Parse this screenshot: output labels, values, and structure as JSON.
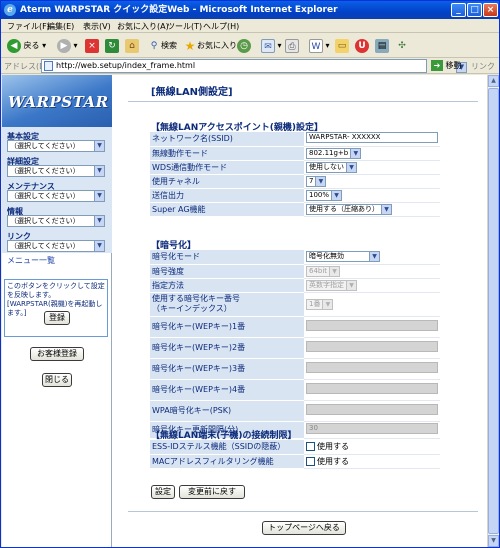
{
  "window": {
    "title": "Aterm WARPSTAR クイック設定Web - Microsoft Internet Explorer",
    "minimize_glyph": "_",
    "maximize_glyph": "□",
    "close_glyph": "×"
  },
  "menubar": [
    "ファイル(F)",
    "編集(E)",
    "表示(V)",
    "お気に入り(A)",
    "ツール(T)",
    "ヘルプ(H)"
  ],
  "toolbar": {
    "back_label": "戻る",
    "search_label": "検索",
    "favorites_label": "お気に入り"
  },
  "address_bar": {
    "label": "アドレス(D)",
    "url": "http://web.setup/index_frame.html",
    "go_label": "移動",
    "links_label": "リンク"
  },
  "sidebar": {
    "logo_text": "WARPSTAR",
    "groups": [
      {
        "label": "基本設定",
        "selected": "（選択してください）"
      },
      {
        "label": "詳細設定",
        "selected": "（選択してください）"
      },
      {
        "label": "メンテナンス",
        "selected": "（選択してください）"
      },
      {
        "label": "情報",
        "selected": "（選択してください）"
      },
      {
        "label": "リンク",
        "selected": "（選択してください）"
      }
    ],
    "menu_list_link": "メニュー一覧",
    "hint_text": "このボタンをクリックして設定を反映します。[WARPSTAR(親機)を再起動します。]",
    "register_button": "登録",
    "customer_register_button": "お客様登録",
    "close_button": "閉じる"
  },
  "page": {
    "title": "[無線LAN側設定]",
    "ap_section": {
      "title": "【無線LANアクセスポイント(親機)設定】",
      "rows": [
        {
          "label": "ネットワーク名(SSID)",
          "value": "WARPSTAR- XXXXXX"
        },
        {
          "label": "無線動作モード",
          "value": "802.11g+b"
        },
        {
          "label": "WDS通信動作モード",
          "value": "使用しない"
        },
        {
          "label": "使用チャネル",
          "value": "7"
        },
        {
          "label": "送信出力",
          "value": "100%"
        },
        {
          "label": "Super AG機能",
          "value": "使用する（圧縮あり）"
        }
      ]
    },
    "enc_section": {
      "title": "【暗号化】",
      "rows": [
        {
          "label": "暗号化モード",
          "value": "暗号化無効"
        },
        {
          "label": "暗号強度",
          "value": "64bit"
        },
        {
          "label": "指定方法",
          "value": "英数字指定"
        },
        {
          "label": "使用する暗号化キー番号\n（キーインデックス）",
          "value": "1番"
        },
        {
          "label": "暗号化キー(WEPキー)1番",
          "value": ""
        },
        {
          "label": "暗号化キー(WEPキー)2番",
          "value": ""
        },
        {
          "label": "暗号化キー(WEPキー)3番",
          "value": ""
        },
        {
          "label": "暗号化キー(WEPキー)4番",
          "value": ""
        },
        {
          "label": "WPA暗号化キー(PSK)",
          "value": ""
        },
        {
          "label": "暗号化キー更新間隔(分)",
          "value": "30"
        }
      ]
    },
    "conn_section": {
      "title": "【無線LAN端末(子機)の接続制限】",
      "rows": [
        {
          "label": "ESS-IDステルス機能（SSIDの隠蔽）",
          "value": "使用する"
        },
        {
          "label": "MACアドレスフィルタリング機能",
          "value": "使用する"
        }
      ]
    },
    "set_button": "設定",
    "revert_button": "変更前に戻す",
    "top_page_button": "トップページへ戻る"
  }
}
